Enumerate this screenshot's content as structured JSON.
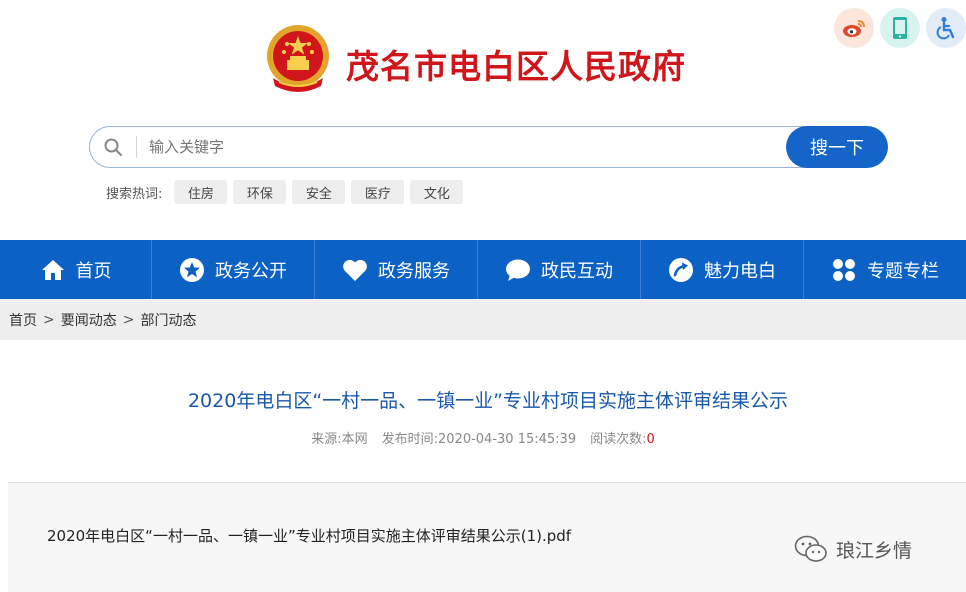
{
  "header": {
    "site_title": "茂名市电白区人民政府",
    "emblem_icon": "national-emblem-icon",
    "top_icons": [
      "weibo-icon",
      "mobile-icon",
      "accessibility-icon"
    ]
  },
  "search": {
    "placeholder": "输入关键字",
    "button_label": "搜一下",
    "hot_label": "搜索热词:",
    "hot_words": [
      "住房",
      "环保",
      "安全",
      "医疗",
      "文化"
    ]
  },
  "nav": {
    "items": [
      {
        "label": "首页",
        "icon": "home-icon"
      },
      {
        "label": "政务公开",
        "icon": "star-icon"
      },
      {
        "label": "政务服务",
        "icon": "heart-icon"
      },
      {
        "label": "政民互动",
        "icon": "chat-icon"
      },
      {
        "label": "魅力电白",
        "icon": "arrow-circle-icon"
      },
      {
        "label": "专题专栏",
        "icon": "grid-icon"
      }
    ]
  },
  "breadcrumb": {
    "items": [
      "首页",
      "要闻动态",
      "部门动态"
    ],
    "separator": ">"
  },
  "article": {
    "title": "2020年电白区“一村一品、一镇一业”专业村项目实施主体评审结果公示",
    "source_label": "来源:",
    "source": "本网",
    "publish_label": "发布时间:",
    "publish_time": "2020-04-30 15:45:39",
    "views_label": "阅读次数:",
    "views": "0",
    "attachment": "2020年电白区“一村一品、一镇一业”专业村项目实施主体评审结果公示(1).pdf"
  },
  "watermark": {
    "text": "琅江乡情",
    "icon": "wechat-icon"
  },
  "colors": {
    "brand_red": "#d0161b",
    "nav_blue": "#0b61c4",
    "title_blue": "#1a58a8"
  }
}
